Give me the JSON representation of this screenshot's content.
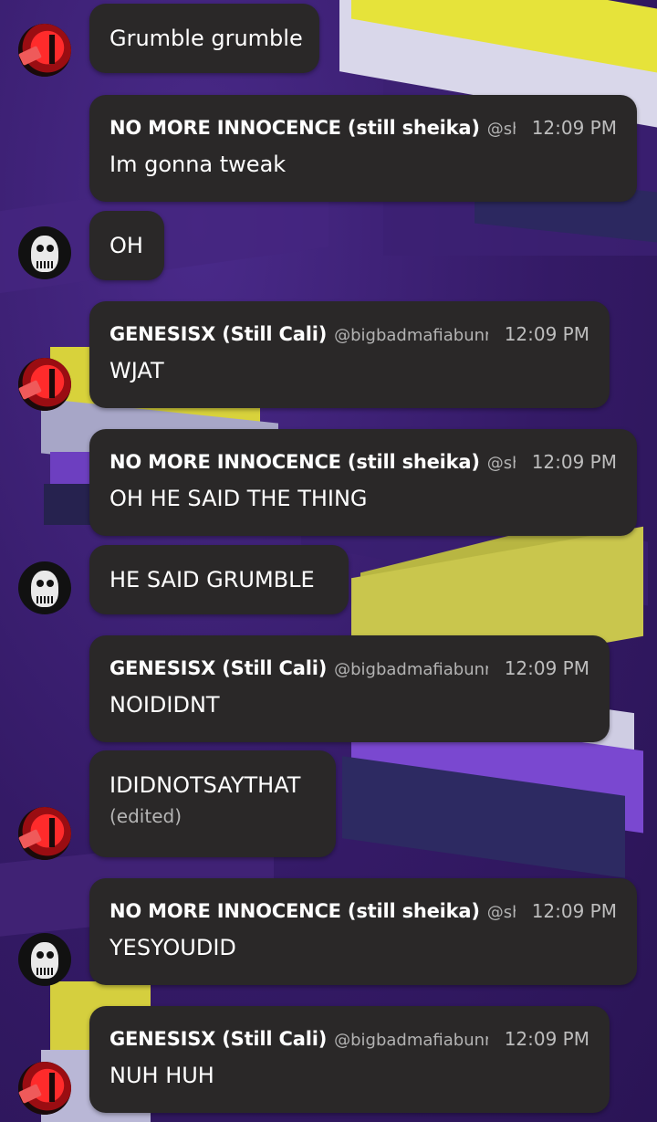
{
  "messages": [
    {
      "type": "cont",
      "text": "Grumble grumble"
    },
    {
      "type": "full",
      "name": "NO MORE INNOCENCE (still sheika)",
      "handle": "@she",
      "time": "12:09 PM",
      "text": "Im gonna tweak"
    },
    {
      "type": "cont",
      "text": "OH"
    },
    {
      "type": "full",
      "name": "GENESISX (Still Cali)",
      "handle": "@bigbadmafiabunny",
      "time": "12:09 PM",
      "text": "WJAT"
    },
    {
      "type": "full",
      "name": "NO MORE INNOCENCE (still sheika)",
      "handle": "@she",
      "time": "12:09 PM",
      "text": "OH HE SAID THE THING"
    },
    {
      "type": "cont",
      "text": "HE SAID GRUMBLE"
    },
    {
      "type": "full",
      "name": "GENESISX (Still Cali)",
      "handle": "@bigbadmafiabunny",
      "time": "12:09 PM",
      "text": "NOIDIDNT"
    },
    {
      "type": "cont",
      "text": "IDIDNOTSAYTHAT",
      "edited": "(edited)"
    },
    {
      "type": "full",
      "name": "NO MORE INNOCENCE (still sheika)",
      "handle": "@she",
      "time": "12:09 PM",
      "text": "YESYOUDID"
    },
    {
      "type": "full",
      "name": "GENESISX (Still Cali)",
      "handle": "@bigbadmafiabunny",
      "time": "12:09 PM",
      "text": "NUH HUH"
    }
  ]
}
